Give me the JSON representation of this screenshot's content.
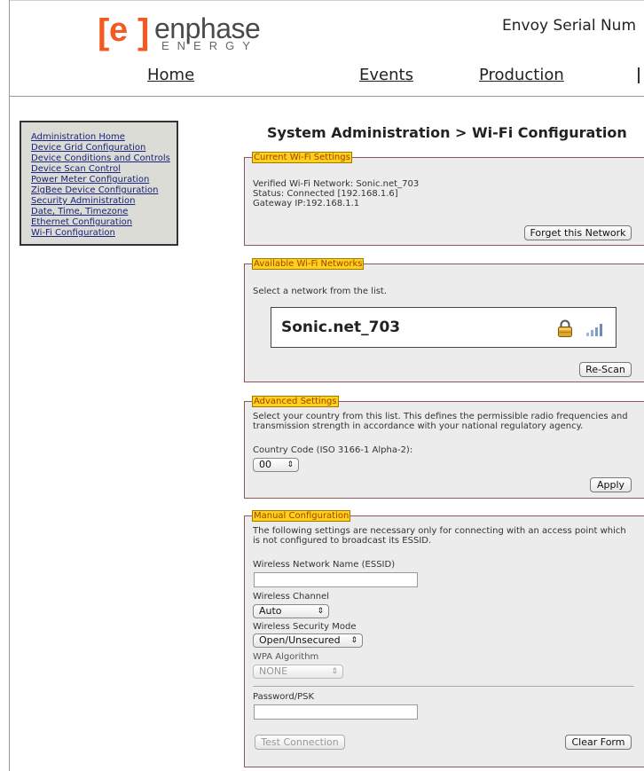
{
  "header": {
    "logo_bracket_left": "[",
    "logo_e": "e",
    "logo_bracket_right": "]",
    "logo_brand": "enphase",
    "logo_energy": "ENERGY",
    "serial_label": "Envoy Serial Num"
  },
  "nav": {
    "home": "Home",
    "events": "Events",
    "production": "Production"
  },
  "sidebar": {
    "items": [
      {
        "label": "Administration Home"
      },
      {
        "label": "Device Grid Configuration"
      },
      {
        "label": "Device Conditions and Controls"
      },
      {
        "label": "Device Scan Control"
      },
      {
        "label": "Power Meter Configuration"
      },
      {
        "label": "ZigBee Device Configuration"
      },
      {
        "label": "Security Administration"
      },
      {
        "label": "Date, Time, Timezone"
      },
      {
        "label": "Ethernet Configuration"
      },
      {
        "label": "Wi-Fi Configuration"
      }
    ]
  },
  "page": {
    "title": "System Administration > Wi-Fi Configuration"
  },
  "current": {
    "legend": "Current Wi-Fi Settings",
    "network": "Verified Wi-Fi Network: Sonic.net_703",
    "status": "Status: Connected [192.168.1.6]",
    "gateway": "Gateway IP:192.168.1.1",
    "forget_button": "Forget this Network"
  },
  "available": {
    "legend": "Available Wi-Fi Networks",
    "instruction": "Select a network from the list.",
    "networks": [
      {
        "name": "Sonic.net_703",
        "secured_icon": "lock-icon",
        "signal_icon": "signal-strength-icon"
      }
    ],
    "rescan_button": "Re-Scan"
  },
  "advanced": {
    "legend": "Advanced Settings",
    "description_line1": "Select your country from this list. This defines the permissible radio frequencies and",
    "description_line2": "transmission strength in accordance with your national regulatory agency.",
    "country_label": "Country Code (ISO 3166-1 Alpha-2):",
    "country_value": "00",
    "apply_button": "Apply"
  },
  "manual": {
    "legend": "Manual Configuration",
    "description_line1": "The following settings are necessary only for connecting with an access point which",
    "description_line2": "is not configured to broadcast its ESSID.",
    "essid_label": "Wireless Network Name (ESSID)",
    "essid_value": "",
    "channel_label": "Wireless Channel",
    "channel_value": "Auto",
    "security_label": "Wireless Security Mode",
    "security_value": "Open/Unsecured",
    "wpa_label": "WPA Algorithm",
    "wpa_value": "NONE",
    "password_label": "Password/PSK",
    "password_value": "",
    "test_button": "Test Connection",
    "clear_button": "Clear Form"
  },
  "colors": {
    "brand_orange": "#f15a22",
    "legend_yellow": "#ffd11a",
    "link_blue": "#1a237e",
    "fieldset_border": "#8b5a5a"
  }
}
